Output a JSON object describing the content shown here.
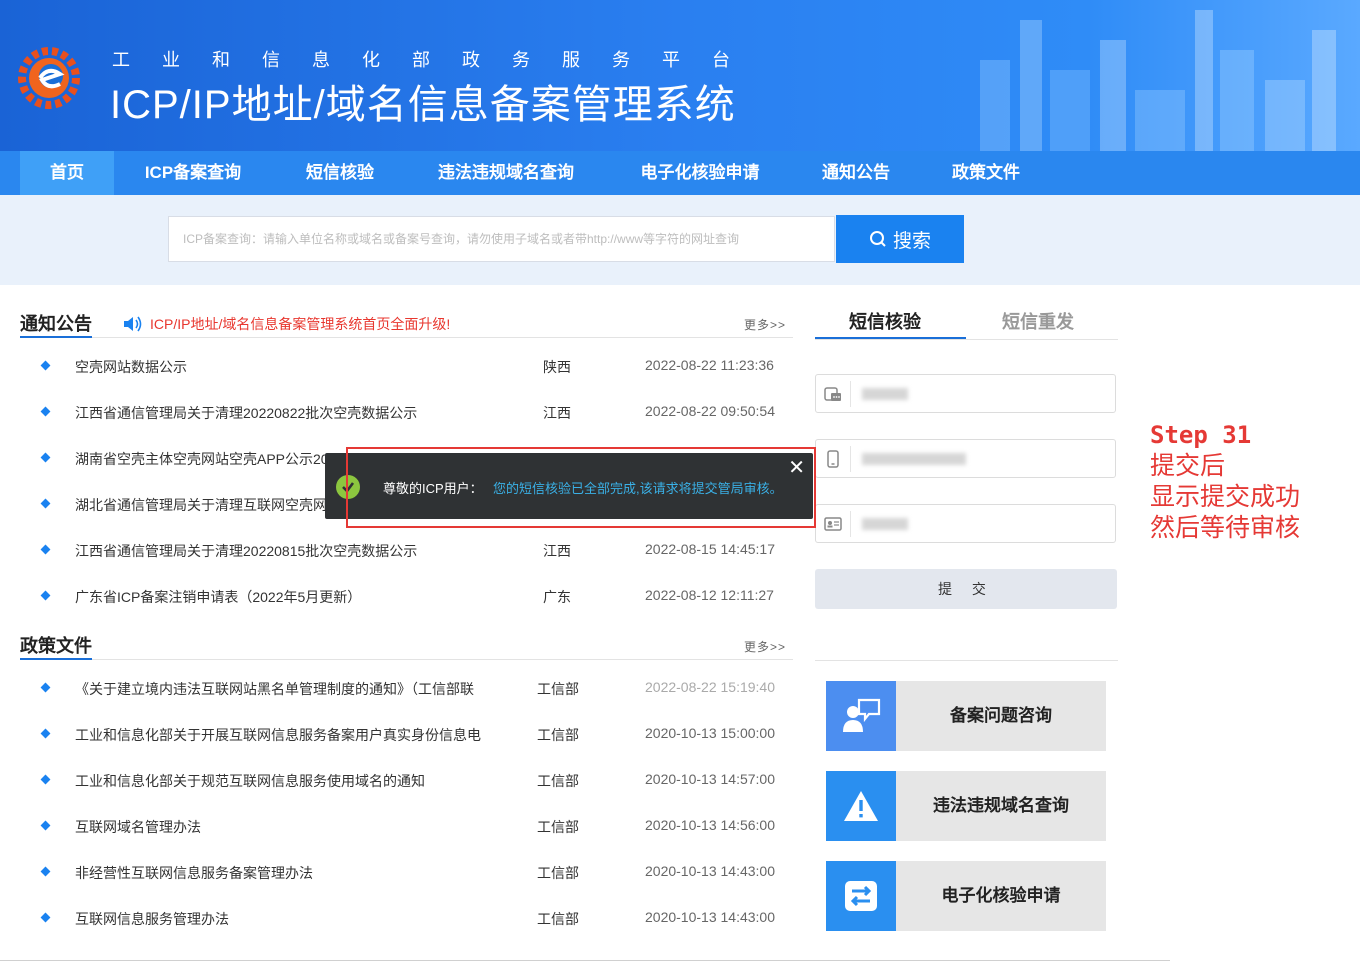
{
  "header": {
    "subtitle": "工业和信息化部政务服务平台",
    "title": "ICP/IP地址/域名信息备案管理系统"
  },
  "nav": {
    "items": [
      {
        "label": "首页"
      },
      {
        "label": "ICP备案查询"
      },
      {
        "label": "短信核验"
      },
      {
        "label": "违法违规域名查询"
      },
      {
        "label": "电子化核验申请"
      },
      {
        "label": "通知公告"
      },
      {
        "label": "政策文件"
      }
    ]
  },
  "search": {
    "placeholder": "ICP备案查询：请输入单位名称或域名或备案号查询，请勿使用子域名或者带http://www等字符的网址查询",
    "button_label": "搜索"
  },
  "notices": {
    "title": "通知公告",
    "ticker": "ICP/IP地址/域名信息备案管理系统首页全面升级!",
    "more": "更多>>",
    "rows": [
      {
        "title": "空壳网站数据公示",
        "province": "陕西",
        "date": "2022-08-22 11:23:36"
      },
      {
        "title": "江西省通信管理局关于清理20220822批次空壳数据公示",
        "province": "江西",
        "date": "2022-08-22 09:50:54"
      },
      {
        "title": "湖南省空壳主体空壳网站空壳APP公示20",
        "province": "",
        "date": ""
      },
      {
        "title": "湖北省通信管理局关于清理互联网空壳网",
        "province": "",
        "date": ""
      },
      {
        "title": "江西省通信管理局关于清理20220815批次空壳数据公示",
        "province": "江西",
        "date": "2022-08-15 14:45:17"
      },
      {
        "title": "广东省ICP备案注销申请表（2022年5月更新）",
        "province": "广东",
        "date": "2022-08-12 12:11:27"
      }
    ]
  },
  "policies": {
    "title": "政策文件",
    "more": "更多>>",
    "rows": [
      {
        "title": "《关于建立境内违法互联网站黑名单管理制度的通知》（工信部联",
        "dept": "工信部",
        "date": "2022-08-22 15:19:40"
      },
      {
        "title": "工业和信息化部关于开展互联网信息服务备案用户真实身份信息电",
        "dept": "工信部",
        "date": "2020-10-13 15:00:00"
      },
      {
        "title": "工业和信息化部关于规范互联网信息服务使用域名的通知",
        "dept": "工信部",
        "date": "2020-10-13 14:57:00"
      },
      {
        "title": "互联网域名管理办法",
        "dept": "工信部",
        "date": "2020-10-13 14:56:00"
      },
      {
        "title": "非经营性互联网信息服务备案管理办法",
        "dept": "工信部",
        "date": "2020-10-13 14:43:00"
      },
      {
        "title": "互联网信息服务管理办法",
        "dept": "工信部",
        "date": "2020-10-13 14:43:00"
      }
    ]
  },
  "sms": {
    "tab_active": "短信核验",
    "tab_inactive": "短信重发",
    "submit_label": "提 交"
  },
  "cards": [
    {
      "label": "备案问题咨询"
    },
    {
      "label": "违法违规域名查询"
    },
    {
      "label": "电子化核验申请"
    }
  ],
  "toast": {
    "greeting": "尊敬的ICP用户：",
    "message": "您的短信核验已全部完成,该请求将提交管局审核。",
    "close": "✕"
  },
  "annotation": {
    "step": "Step 31",
    "line1": "提交后",
    "line2": "显示提交成功",
    "line3": "然后等待审核"
  },
  "colors": {
    "nav": "#2a87ef",
    "accent": "#1a82f0",
    "alert_red": "#e53935",
    "card_icon_bg": "#4c8ef0"
  }
}
